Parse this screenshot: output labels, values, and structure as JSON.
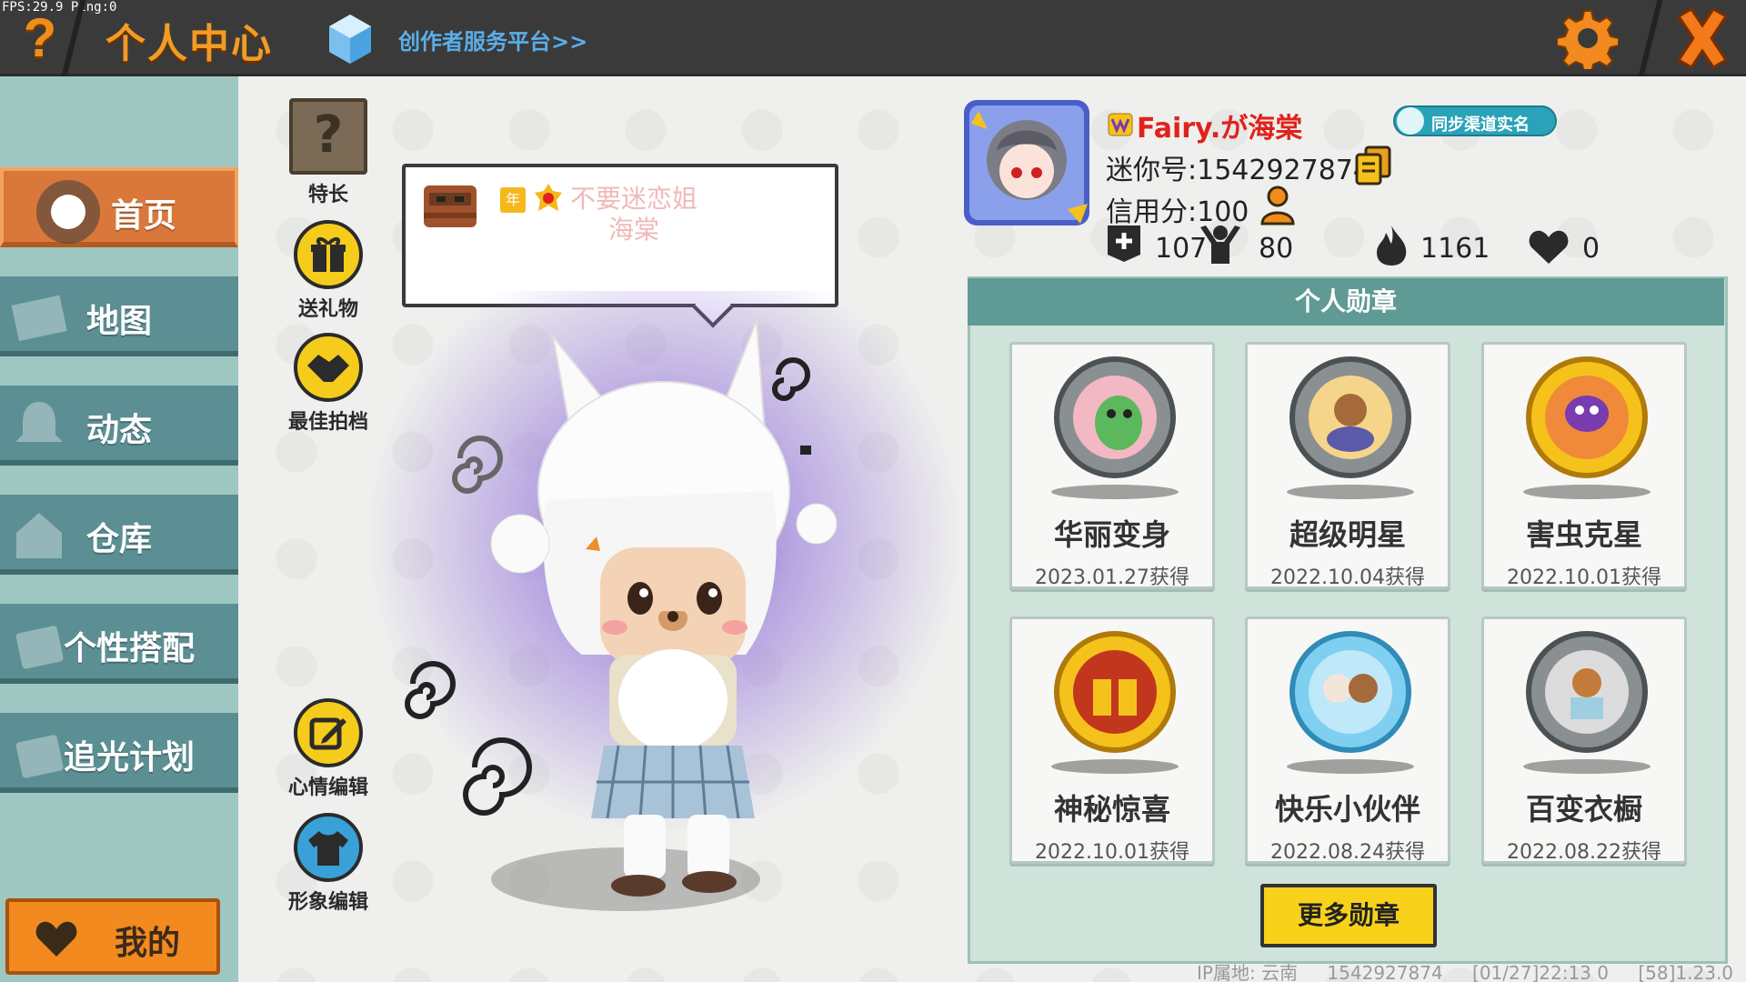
{
  "debug": {
    "fps": "FPS:29.9  Ping:0"
  },
  "header": {
    "help_glyph": "?",
    "title": "个人中心",
    "creator_link": "创作者服务平台>>",
    "settings_icon": "gear-icon",
    "close_icon": "close-icon"
  },
  "sidebar": {
    "items": [
      {
        "label": "首页",
        "icon": "home-icon",
        "active": true
      },
      {
        "label": "地图",
        "icon": "map-icon"
      },
      {
        "label": "动态",
        "icon": "bell-icon"
      },
      {
        "label": "仓库",
        "icon": "storage-icon"
      },
      {
        "label": "个性搭配",
        "icon": "outfit-icon"
      },
      {
        "label": "追光计划",
        "icon": "spotlight-icon"
      }
    ],
    "mine_label": "我的"
  },
  "actions": {
    "specialty": {
      "glyph": "?",
      "label": "特长"
    },
    "gift": {
      "label": "送礼物"
    },
    "best_photo": {
      "label": "最佳拍档"
    },
    "mood_edit": {
      "label": "心情编辑"
    },
    "avatar_edit": {
      "label": "形象编辑"
    }
  },
  "bubble": {
    "badge": "年",
    "text": "不要迷恋姐海棠"
  },
  "profile": {
    "username": "Fairy.が海棠",
    "sync_label": "同步渠道实名",
    "mini_id": "迷你号:1542927874",
    "credit": "信用分:100",
    "stats": {
      "posts": "107",
      "followers": "80",
      "hot": "1161",
      "likes": "0"
    }
  },
  "medals": {
    "header": "个人勋章",
    "items": [
      {
        "name": "华丽变身",
        "date": "2023.01.27获得",
        "tier": "silver"
      },
      {
        "name": "超级明星",
        "date": "2022.10.04获得",
        "tier": "silver"
      },
      {
        "name": "害虫克星",
        "date": "2022.10.01获得",
        "tier": "gold"
      },
      {
        "name": "神秘惊喜",
        "date": "2022.10.01获得",
        "tier": "gold"
      },
      {
        "name": "快乐小伙伴",
        "date": "2022.08.24获得",
        "tier": "diamond"
      },
      {
        "name": "百变衣橱",
        "date": "2022.08.22获得",
        "tier": "silver"
      }
    ],
    "more_label": "更多勋章"
  },
  "footer": {
    "ip": "IP属地: 云南",
    "uid": "1542927874",
    "time": "[01/27]22:13 0",
    "version": "[58]1.23.0"
  },
  "colors": {
    "accent_orange": "#f29b26",
    "sidebar_teal": "#5b8f93",
    "active_orange": "#d9783a",
    "username_red": "#e0221d",
    "button_yellow": "#f8d21a"
  }
}
